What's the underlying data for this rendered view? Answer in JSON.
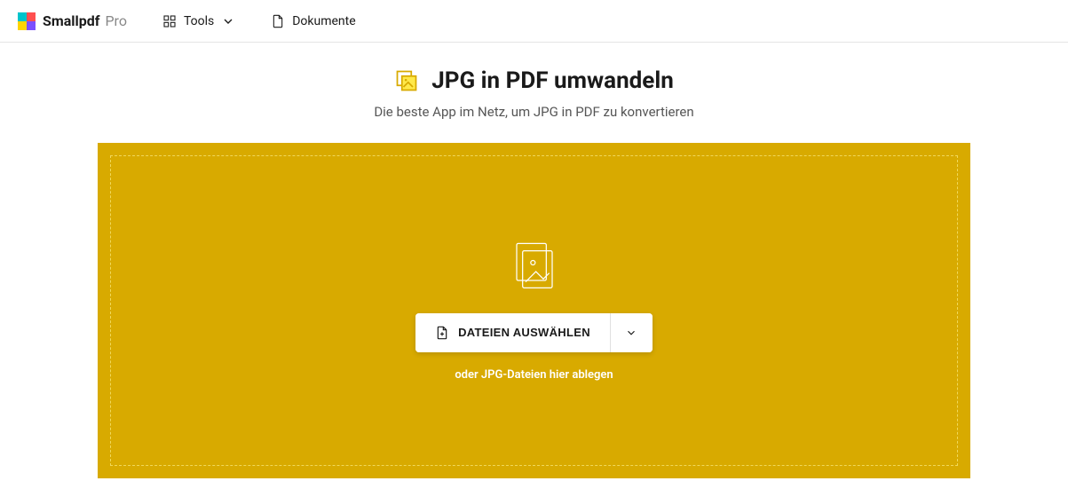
{
  "header": {
    "brand_name": "Smallpdf",
    "brand_tier": "Pro",
    "tools_label": "Tools",
    "documents_label": "Dokumente"
  },
  "hero": {
    "title": "JPG in PDF umwandeln",
    "subtitle": "Die beste App im Netz, um JPG in PDF zu konvertieren"
  },
  "dropzone": {
    "choose_label": "DATEIEN AUSWÄHLEN",
    "hint": "oder JPG-Dateien hier ablegen"
  },
  "colors": {
    "accent": "#d8aa00"
  }
}
